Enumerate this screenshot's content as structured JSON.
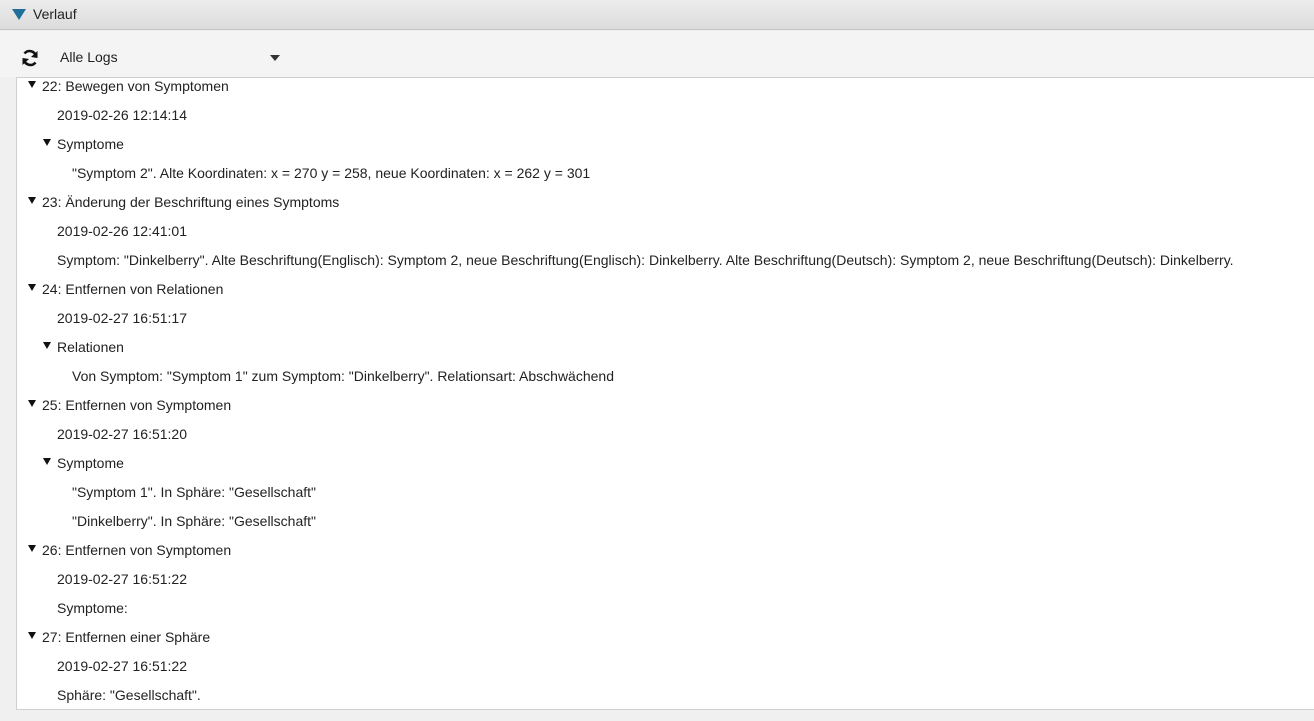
{
  "panel": {
    "title": "Verlauf"
  },
  "toolbar": {
    "refresh_icon": "refresh-icon",
    "filter_selected": "Alle Logs"
  },
  "log": [
    {
      "header": "22: Bewegen von Symptomen",
      "timestamp": "2019-02-26 12:14:14",
      "group": "Symptome",
      "items": [
        "\"Symptom 2\". Alte Koordinaten: x = 270 y = 258, neue Koordinaten: x = 262 y = 301"
      ]
    },
    {
      "header": "23: Änderung der Beschriftung eines Symptoms",
      "timestamp": "2019-02-26 12:41:01",
      "detail": "Symptom: \"Dinkelberry\". Alte Beschriftung(Englisch): Symptom 2, neue Beschriftung(Englisch): Dinkelberry. Alte Beschriftung(Deutsch): Symptom 2, neue Beschriftung(Deutsch): Dinkelberry."
    },
    {
      "header": "24: Entfernen von Relationen",
      "timestamp": "2019-02-27 16:51:17",
      "group": "Relationen",
      "items": [
        "Von Symptom: \"Symptom 1\" zum Symptom: \"Dinkelberry\". Relationsart: Abschwächend"
      ]
    },
    {
      "header": "25: Entfernen von Symptomen",
      "timestamp": "2019-02-27 16:51:20",
      "group": "Symptome",
      "items": [
        "\"Symptom 1\". In Sphäre: \"Gesellschaft\"",
        "\"Dinkelberry\". In Sphäre: \"Gesellschaft\""
      ]
    },
    {
      "header": "26: Entfernen von Symptomen",
      "timestamp": "2019-02-27 16:51:22",
      "detail": "Symptome:"
    },
    {
      "header": "27: Entfernen einer Sphäre",
      "timestamp": "2019-02-27 16:51:22",
      "detail": "Sphäre: \"Gesellschaft\"."
    }
  ]
}
